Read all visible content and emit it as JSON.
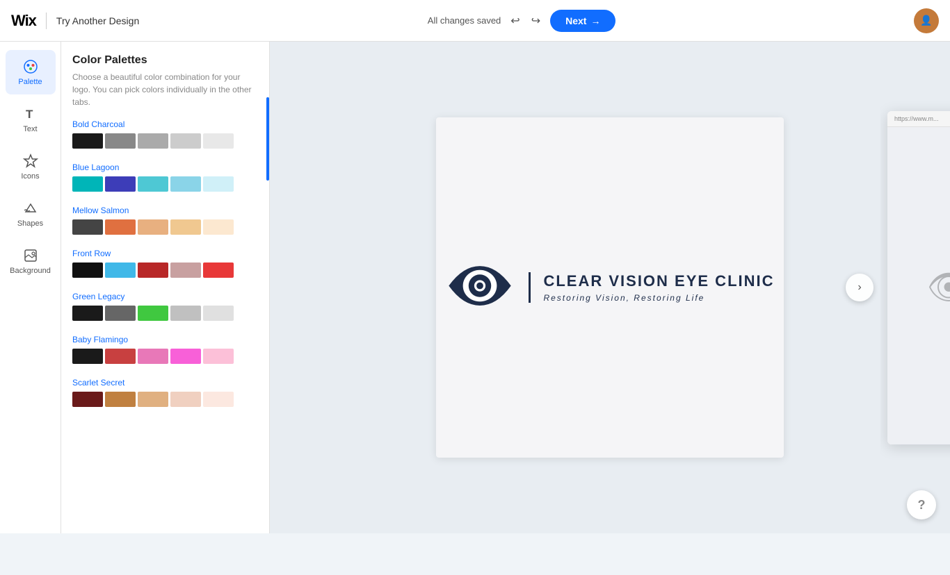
{
  "header": {
    "logo_text": "Wix",
    "title": "Try Another Design",
    "changes_status": "All changes saved",
    "undo_label": "↩",
    "redo_label": "↪",
    "next_label": "Next",
    "next_arrow": "→"
  },
  "sidebar": {
    "items": [
      {
        "id": "palette",
        "label": "Palette",
        "icon": "palette",
        "active": true
      },
      {
        "id": "text",
        "label": "Text",
        "icon": "text",
        "active": false
      },
      {
        "id": "icons",
        "label": "Icons",
        "icon": "icons",
        "active": false
      },
      {
        "id": "shapes",
        "label": "Shapes",
        "icon": "shapes",
        "active": false
      },
      {
        "id": "background",
        "label": "Background",
        "icon": "background",
        "active": false
      }
    ]
  },
  "panel": {
    "title": "Color Palettes",
    "description": "Choose a beautiful color combination for your logo. You can pick colors individually in the other tabs.",
    "palettes": [
      {
        "name": "Bold Charcoal",
        "swatches": [
          "#1a1a1a",
          "#888888",
          "#aaaaaa",
          "#cccccc",
          "#e8e8e8"
        ]
      },
      {
        "name": "Blue Lagoon",
        "swatches": [
          "#00b5b8",
          "#3d3db8",
          "#4ec8d4",
          "#8ad4e8",
          "#d0f0f8"
        ]
      },
      {
        "name": "Mellow Salmon",
        "swatches": [
          "#444444",
          "#e07040",
          "#e8b080",
          "#f0c890",
          "#fce8d0"
        ]
      },
      {
        "name": "Front Row",
        "swatches": [
          "#111111",
          "#40b8e8",
          "#b82828",
          "#c8a0a0",
          "#e83838"
        ]
      },
      {
        "name": "Green Legacy",
        "swatches": [
          "#1a1a1a",
          "#666666",
          "#40c840",
          "#c0c0c0",
          "#e0e0e0"
        ]
      },
      {
        "name": "Baby Flamingo",
        "swatches": [
          "#1a1a1a",
          "#c84040",
          "#e878b8",
          "#f860d8",
          "#fcc0d8"
        ]
      },
      {
        "name": "Scarlet Secret",
        "swatches": [
          "#6a1a1a",
          "#c08040",
          "#e0b080",
          "#f0d0c0",
          "#fce8e0"
        ]
      }
    ]
  },
  "logo": {
    "main_text": "Clear Vision Eye Clinic",
    "sub_text": "Restoring Vision, Restoring Life"
  },
  "browser_preview": {
    "url": "https://www.m..."
  },
  "help": {
    "label": "?"
  }
}
